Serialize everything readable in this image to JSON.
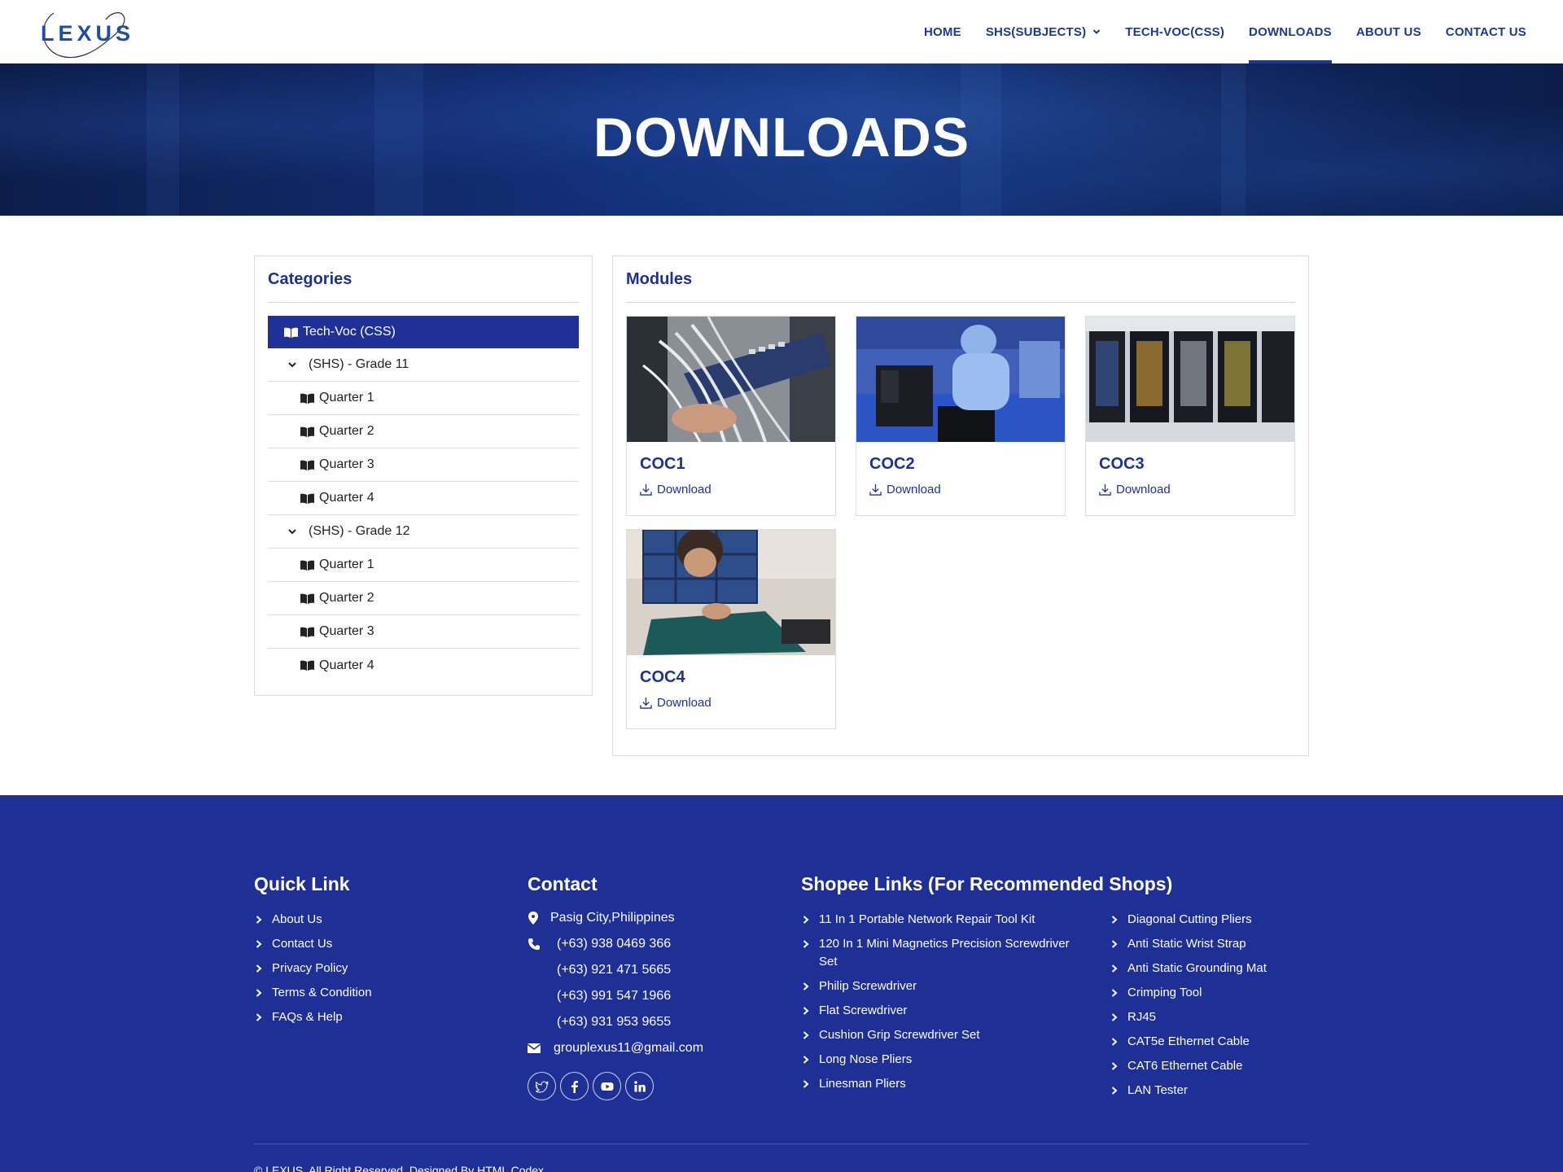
{
  "brand": {
    "logo_text": "LEXUS"
  },
  "nav": {
    "items": [
      {
        "label": "HOME"
      },
      {
        "label": "SHS(SUBJECTS)"
      },
      {
        "label": "TECH-VOC(CSS)"
      },
      {
        "label": "DOWNLOADS"
      },
      {
        "label": "ABOUT US"
      },
      {
        "label": "CONTACT US"
      }
    ],
    "active": "DOWNLOADS"
  },
  "hero": {
    "title": "DOWNLOADS"
  },
  "categories": {
    "title": "Categories",
    "active_item": "Tech-Voc (CSS)",
    "groups": [
      {
        "label": "(SHS) - Grade 11",
        "quarters": [
          "Quarter 1",
          "Quarter 2",
          "Quarter 3",
          "Quarter 4"
        ]
      },
      {
        "label": "(SHS) - Grade 12",
        "quarters": [
          "Quarter 1",
          "Quarter 2",
          "Quarter 3",
          "Quarter 4"
        ]
      }
    ]
  },
  "modules": {
    "title": "Modules",
    "items": [
      {
        "title": "COC1",
        "action": "Download"
      },
      {
        "title": "COC2",
        "action": "Download"
      },
      {
        "title": "COC3",
        "action": "Download"
      },
      {
        "title": "COC4",
        "action": "Download"
      }
    ]
  },
  "footer": {
    "quick_link": {
      "title": "Quick Link",
      "items": [
        "About Us",
        "Contact Us",
        "Privacy Policy",
        "Terms & Condition",
        "FAQs & Help"
      ]
    },
    "contact": {
      "title": "Contact",
      "address": "Pasig City,Philippines",
      "phones": [
        "(+63) 938 0469 366",
        "(+63) 921 471 5665",
        "(+63) 991 547 1966",
        "(+63) 931 953 9655"
      ],
      "email": "grouplexus11@gmail.com"
    },
    "shopee": {
      "title": "Shopee Links (For Recommended Shops)",
      "col1": [
        "11 In 1 Portable Network Repair Tool Kit",
        "120 In 1 Mini Magnetics Precision Screwdriver Set",
        "Philip Screwdriver",
        "Flat Screwdriver",
        "Cushion Grip Screwdriver Set",
        "Long Nose Pliers",
        "Linesman Pliers"
      ],
      "col2": [
        "Diagonal Cutting Pliers",
        "Anti Static Wrist Strap",
        "Anti Static Grounding Mat",
        "Crimping Tool",
        "RJ45",
        "CAT5e Ethernet Cable",
        "CAT6 Ethernet Cable",
        "LAN Tester"
      ]
    },
    "social_icons": [
      "twitter-icon",
      "facebook-icon",
      "youtube-icon",
      "linkedin-icon"
    ],
    "copyright": "© LEXUS, All Right Reserved. Designed By HTML Codex"
  },
  "colors": {
    "primary": "#1f3196",
    "nav_text": "#1e3a8a",
    "footer_bg": "#1e2f96",
    "hero_bg": "#0f2660"
  }
}
